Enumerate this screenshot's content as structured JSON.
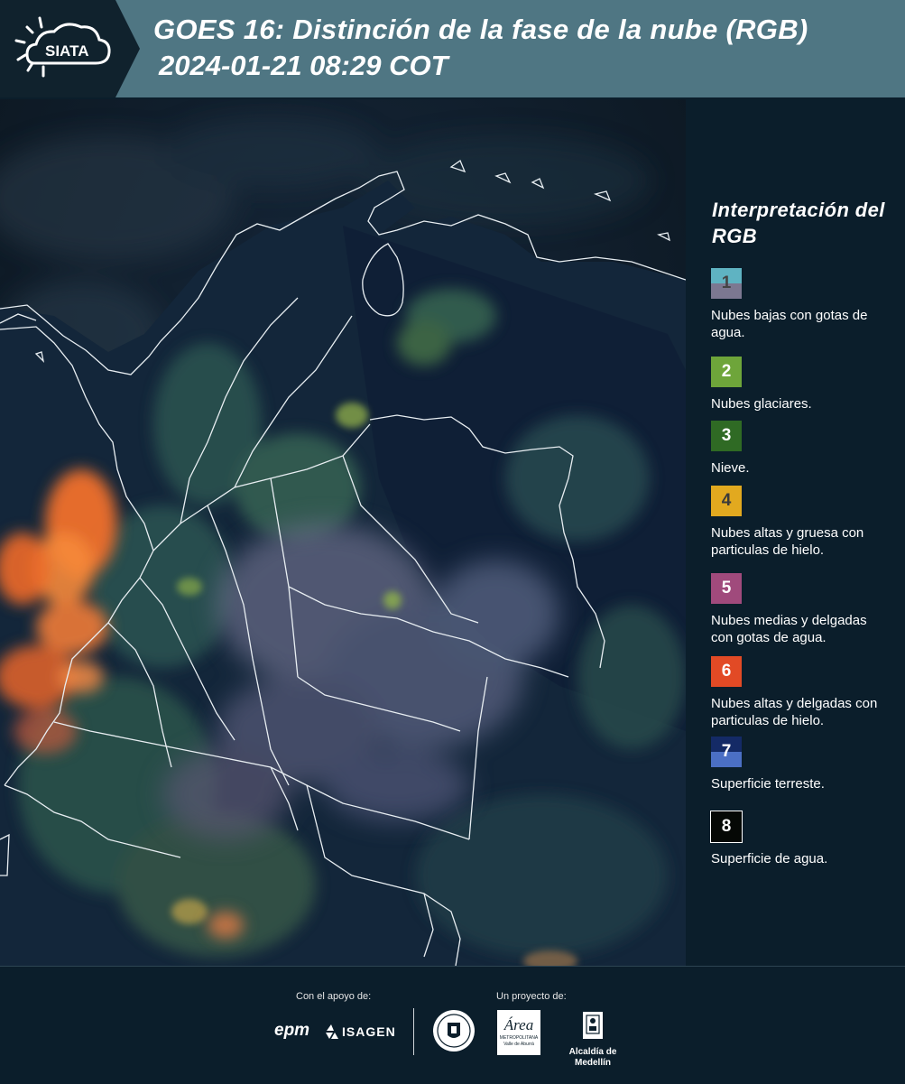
{
  "header": {
    "logo_text": "SIATA",
    "title": "GOES 16: Distinción de la fase de la nube (RGB)",
    "date": "2024-01-21 08:29 COT"
  },
  "legend": {
    "title": "Interpretación del RGB",
    "items": [
      {
        "num": "1",
        "label": "Nubes bajas con gotas de agua.",
        "top_color": "#5fb3c2",
        "bottom_color": "#7c7891",
        "num_color": "#444444"
      },
      {
        "num": "2",
        "label": "Nubes glaciares.",
        "top_color": "#6ea53a",
        "bottom_color": "#6ea53a",
        "num_color": "#ffffff"
      },
      {
        "num": "3",
        "label": "Nieve.",
        "top_color": "#2f6a24",
        "bottom_color": "#2f6a24",
        "num_color": "#ffffff"
      },
      {
        "num": "4",
        "label": "Nubes altas y gruesa con particulas de hielo.",
        "top_color": "#e2a91f",
        "bottom_color": "#e2a91f",
        "num_color": "#3a3a3a"
      },
      {
        "num": "5",
        "label": "Nubes medias y delgadas con gotas de agua.",
        "top_color": "#a04a7c",
        "bottom_color": "#a04a7c",
        "num_color": "#ffffff"
      },
      {
        "num": "6",
        "label": "Nubes altas y delgadas con particulas de hielo.",
        "top_color": "#e24a25",
        "bottom_color": "#e24a25",
        "num_color": "#ffffff"
      },
      {
        "num": "7",
        "label": "Superficie terreste.",
        "top_color": "#142a66",
        "bottom_color": "#4b6fc4",
        "num_color": "#ffffff"
      },
      {
        "num": "8",
        "label": "Superficie de agua.",
        "top_color": "#050805",
        "bottom_color": "#050805",
        "num_color": "#ffffff"
      }
    ]
  },
  "footer": {
    "support_label": "Con el apoyo de:",
    "project_label": "Un proyecto de:",
    "epm_text": "epm",
    "isagen_text": "ISAGEN",
    "area_text": "Área",
    "area_sub": "METROPOLITANA",
    "area_sub2": "Valle de Aburrá",
    "alcaldia_text": "Alcaldía de Medellín"
  },
  "colors": {
    "header_bg": "#4f7683",
    "logo_bg": "#10222d",
    "panel_bg": "#0b1e2b"
  }
}
